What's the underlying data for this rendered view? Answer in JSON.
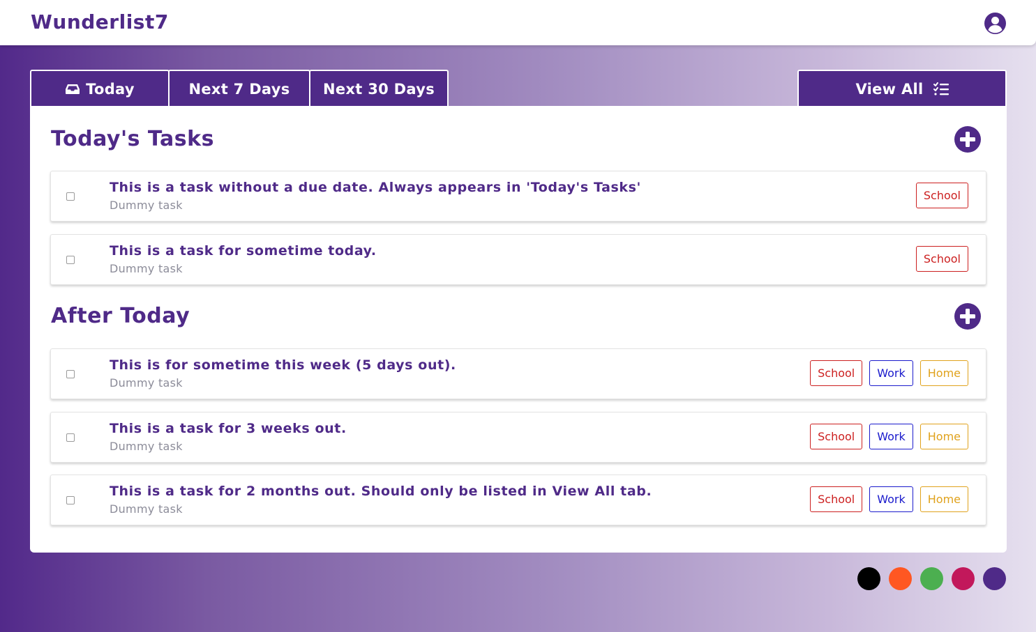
{
  "app": {
    "title": "Wunderlist7"
  },
  "header": {
    "user_icon": "user-circle-icon"
  },
  "tabs": [
    {
      "label": "Today",
      "icon": "inbox-icon"
    },
    {
      "label": "Next 7 Days"
    },
    {
      "label": "Next 30 Days"
    }
  ],
  "view_all": {
    "label": "View All",
    "icon": "list-check-icon"
  },
  "sections": [
    {
      "title": "Today's Tasks",
      "add_icon": "plus-circle-icon",
      "tasks": [
        {
          "title": "This is a task without a due date. Always appears in 'Today's Tasks'",
          "subtitle": "Dummy task",
          "tags": [
            "School"
          ]
        },
        {
          "title": "This is a task for sometime today.",
          "subtitle": "Dummy task",
          "tags": [
            "School"
          ]
        }
      ]
    },
    {
      "title": "After Today",
      "add_icon": "plus-circle-icon",
      "tasks": [
        {
          "title": "This is for sometime this week (5 days out).",
          "subtitle": "Dummy task",
          "tags": [
            "School",
            "Work",
            "Home"
          ]
        },
        {
          "title": "This is a task for 3 weeks out.",
          "subtitle": "Dummy task",
          "tags": [
            "School",
            "Work",
            "Home"
          ]
        },
        {
          "title": "This is a task for 2 months out. Should only be listed in View All tab.",
          "subtitle": "Dummy task",
          "tags": [
            "School",
            "Work",
            "Home"
          ]
        }
      ]
    }
  ],
  "theme_colors": [
    "#000000",
    "#ff5722",
    "#4caf50",
    "#c2185b",
    "#4f2a88"
  ],
  "colors": {
    "accent": "#4f2a88",
    "tag_school": "#cc1f1f",
    "tag_work": "#1a1acc",
    "tag_home": "#e0a21c"
  }
}
